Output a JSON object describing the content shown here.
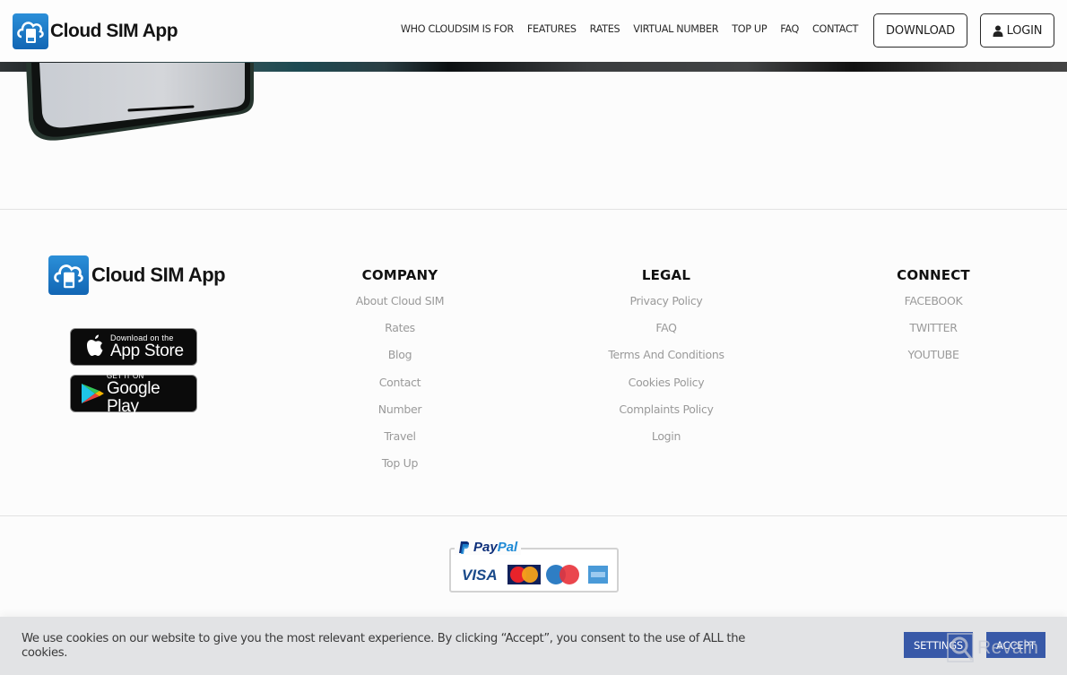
{
  "header": {
    "logo_text": "Cloud SIM App",
    "nav": [
      {
        "label": "WHO CLOUDSIM IS FOR"
      },
      {
        "label": "FEATURES"
      },
      {
        "label": "RATES"
      },
      {
        "label": "VIRTUAL NUMBER"
      },
      {
        "label": "TOP UP"
      },
      {
        "label": "FAQ"
      },
      {
        "label": "CONTACT"
      }
    ],
    "download_label": "DOWNLOAD",
    "login_label": "LOGIN"
  },
  "footer": {
    "logo_text": "Cloud SIM App",
    "app_store": {
      "small": "Download on the",
      "big": "App Store"
    },
    "google_play": {
      "small": "GET IT ON",
      "big": "Google Play"
    },
    "company": {
      "title": "COMPANY",
      "links": [
        "About Cloud SIM",
        "Rates",
        "Blog",
        "Contact",
        "Number",
        "Travel",
        "Top Up"
      ]
    },
    "legal": {
      "title": "LEGAL",
      "links": [
        "Privacy Policy",
        "FAQ",
        "Terms And Conditions",
        "Cookies Policy",
        "Complaints Policy",
        "Login"
      ]
    },
    "connect": {
      "title": "CONNECT",
      "links": [
        "FACEBOOK",
        "TWITTER",
        "YOUTUBE"
      ]
    },
    "payments": {
      "paypal_a": "Pay",
      "paypal_b": "Pal",
      "cards": [
        "VISA",
        "MasterCard",
        "Maestro",
        "American Express"
      ]
    }
  },
  "cookie": {
    "text": "We use cookies on our website to give you the most relevant experience. By clicking “Accept”, you consent to the use of ALL the cookies.",
    "settings_label": "SETTINGS",
    "accept_label": "ACCEPT"
  },
  "watermark": {
    "text": "Revain"
  },
  "colors": {
    "brand_blue": "#1a78c7",
    "cookie_button": "#3859a8",
    "link_gray": "#9a9a9a"
  }
}
